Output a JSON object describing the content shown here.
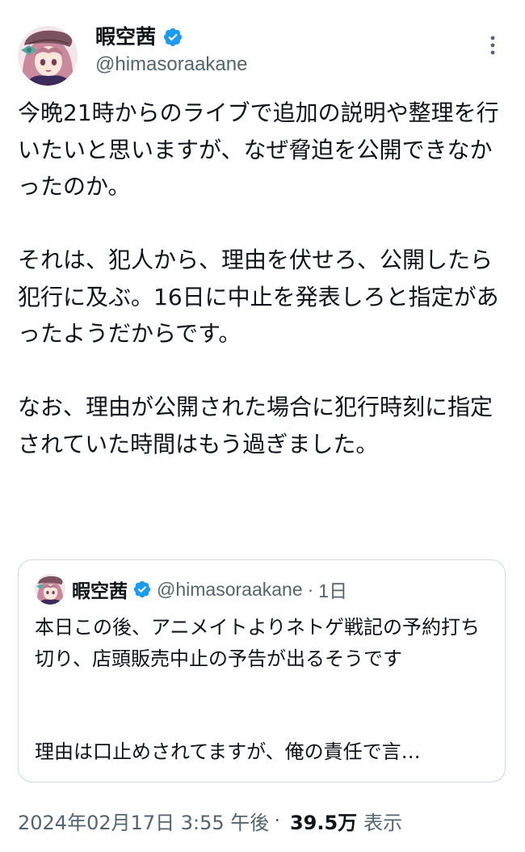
{
  "author": {
    "name": "暇空茜",
    "handle": "@himasoraakane",
    "verified": true
  },
  "tweet": {
    "text": "今晩21時からのライブで追加の説明や整理を行いたいと思いますが、なぜ脅迫を公開できなかったのか。\n\nそれは、犯人から、理由を伏せろ、公開したら犯行に及ぶ。16日に中止を発表しろと指定があったようだからです。\n\nなお、理由が公開された場合に犯行時刻に指定されていた時間はもう過ぎました。"
  },
  "quoted": {
    "name": "暇空茜",
    "handle": "@himasoraakane",
    "separator": "·",
    "time": "1日",
    "text": "本日この後、アニメイトよりネトゲ戦記の予約打ち切り、店頭販売中止の予告が出るそうです",
    "text_continued": "理由は口止めされてますが、俺の責任で言…"
  },
  "meta": {
    "date": "2024年02月17日 3:55 午後",
    "separator": "·",
    "views_count": "39.5万",
    "views_label": "表示"
  },
  "colors": {
    "text_primary": "#0f1419",
    "text_secondary": "#536471",
    "verified_blue": "#1d9bf0",
    "border": "#cfd9de"
  },
  "icons": {
    "verified": "verified-badge-icon",
    "more": "more-options-icon"
  }
}
